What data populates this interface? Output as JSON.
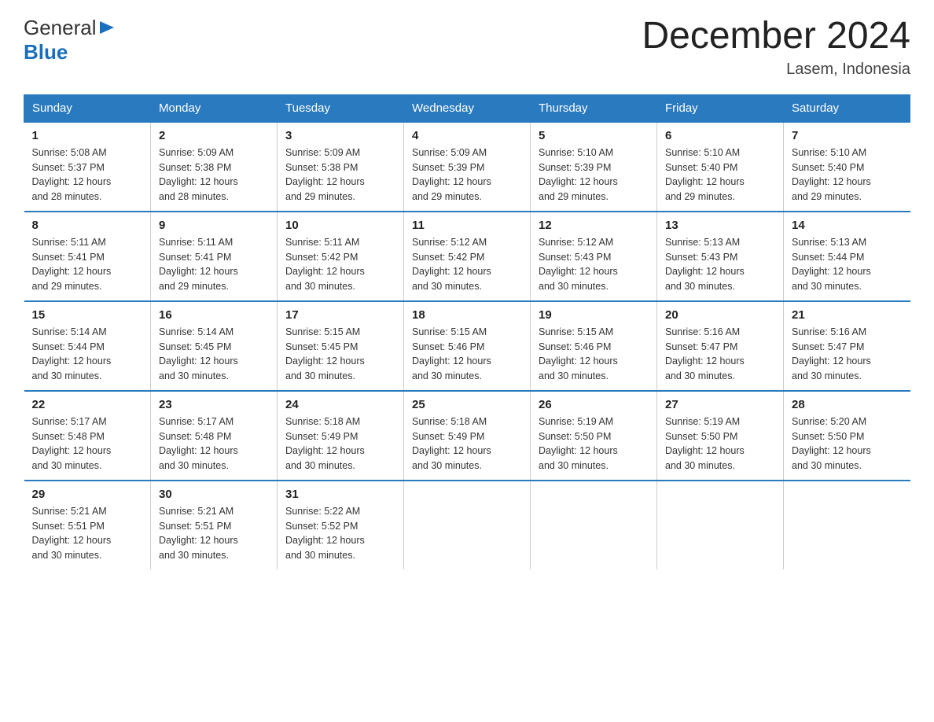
{
  "header": {
    "logo_text1": "General",
    "logo_text2": "Blue",
    "month_title": "December 2024",
    "location": "Lasem, Indonesia"
  },
  "days_of_week": [
    "Sunday",
    "Monday",
    "Tuesday",
    "Wednesday",
    "Thursday",
    "Friday",
    "Saturday"
  ],
  "weeks": [
    [
      {
        "day": "1",
        "sunrise": "5:08 AM",
        "sunset": "5:37 PM",
        "daylight": "12 hours and 28 minutes."
      },
      {
        "day": "2",
        "sunrise": "5:09 AM",
        "sunset": "5:38 PM",
        "daylight": "12 hours and 28 minutes."
      },
      {
        "day": "3",
        "sunrise": "5:09 AM",
        "sunset": "5:38 PM",
        "daylight": "12 hours and 29 minutes."
      },
      {
        "day": "4",
        "sunrise": "5:09 AM",
        "sunset": "5:39 PM",
        "daylight": "12 hours and 29 minutes."
      },
      {
        "day": "5",
        "sunrise": "5:10 AM",
        "sunset": "5:39 PM",
        "daylight": "12 hours and 29 minutes."
      },
      {
        "day": "6",
        "sunrise": "5:10 AM",
        "sunset": "5:40 PM",
        "daylight": "12 hours and 29 minutes."
      },
      {
        "day": "7",
        "sunrise": "5:10 AM",
        "sunset": "5:40 PM",
        "daylight": "12 hours and 29 minutes."
      }
    ],
    [
      {
        "day": "8",
        "sunrise": "5:11 AM",
        "sunset": "5:41 PM",
        "daylight": "12 hours and 29 minutes."
      },
      {
        "day": "9",
        "sunrise": "5:11 AM",
        "sunset": "5:41 PM",
        "daylight": "12 hours and 29 minutes."
      },
      {
        "day": "10",
        "sunrise": "5:11 AM",
        "sunset": "5:42 PM",
        "daylight": "12 hours and 30 minutes."
      },
      {
        "day": "11",
        "sunrise": "5:12 AM",
        "sunset": "5:42 PM",
        "daylight": "12 hours and 30 minutes."
      },
      {
        "day": "12",
        "sunrise": "5:12 AM",
        "sunset": "5:43 PM",
        "daylight": "12 hours and 30 minutes."
      },
      {
        "day": "13",
        "sunrise": "5:13 AM",
        "sunset": "5:43 PM",
        "daylight": "12 hours and 30 minutes."
      },
      {
        "day": "14",
        "sunrise": "5:13 AM",
        "sunset": "5:44 PM",
        "daylight": "12 hours and 30 minutes."
      }
    ],
    [
      {
        "day": "15",
        "sunrise": "5:14 AM",
        "sunset": "5:44 PM",
        "daylight": "12 hours and 30 minutes."
      },
      {
        "day": "16",
        "sunrise": "5:14 AM",
        "sunset": "5:45 PM",
        "daylight": "12 hours and 30 minutes."
      },
      {
        "day": "17",
        "sunrise": "5:15 AM",
        "sunset": "5:45 PM",
        "daylight": "12 hours and 30 minutes."
      },
      {
        "day": "18",
        "sunrise": "5:15 AM",
        "sunset": "5:46 PM",
        "daylight": "12 hours and 30 minutes."
      },
      {
        "day": "19",
        "sunrise": "5:15 AM",
        "sunset": "5:46 PM",
        "daylight": "12 hours and 30 minutes."
      },
      {
        "day": "20",
        "sunrise": "5:16 AM",
        "sunset": "5:47 PM",
        "daylight": "12 hours and 30 minutes."
      },
      {
        "day": "21",
        "sunrise": "5:16 AM",
        "sunset": "5:47 PM",
        "daylight": "12 hours and 30 minutes."
      }
    ],
    [
      {
        "day": "22",
        "sunrise": "5:17 AM",
        "sunset": "5:48 PM",
        "daylight": "12 hours and 30 minutes."
      },
      {
        "day": "23",
        "sunrise": "5:17 AM",
        "sunset": "5:48 PM",
        "daylight": "12 hours and 30 minutes."
      },
      {
        "day": "24",
        "sunrise": "5:18 AM",
        "sunset": "5:49 PM",
        "daylight": "12 hours and 30 minutes."
      },
      {
        "day": "25",
        "sunrise": "5:18 AM",
        "sunset": "5:49 PM",
        "daylight": "12 hours and 30 minutes."
      },
      {
        "day": "26",
        "sunrise": "5:19 AM",
        "sunset": "5:50 PM",
        "daylight": "12 hours and 30 minutes."
      },
      {
        "day": "27",
        "sunrise": "5:19 AM",
        "sunset": "5:50 PM",
        "daylight": "12 hours and 30 minutes."
      },
      {
        "day": "28",
        "sunrise": "5:20 AM",
        "sunset": "5:50 PM",
        "daylight": "12 hours and 30 minutes."
      }
    ],
    [
      {
        "day": "29",
        "sunrise": "5:21 AM",
        "sunset": "5:51 PM",
        "daylight": "12 hours and 30 minutes."
      },
      {
        "day": "30",
        "sunrise": "5:21 AM",
        "sunset": "5:51 PM",
        "daylight": "12 hours and 30 minutes."
      },
      {
        "day": "31",
        "sunrise": "5:22 AM",
        "sunset": "5:52 PM",
        "daylight": "12 hours and 30 minutes."
      },
      null,
      null,
      null,
      null
    ]
  ],
  "labels": {
    "sunrise": "Sunrise:",
    "sunset": "Sunset:",
    "daylight": "Daylight:"
  }
}
